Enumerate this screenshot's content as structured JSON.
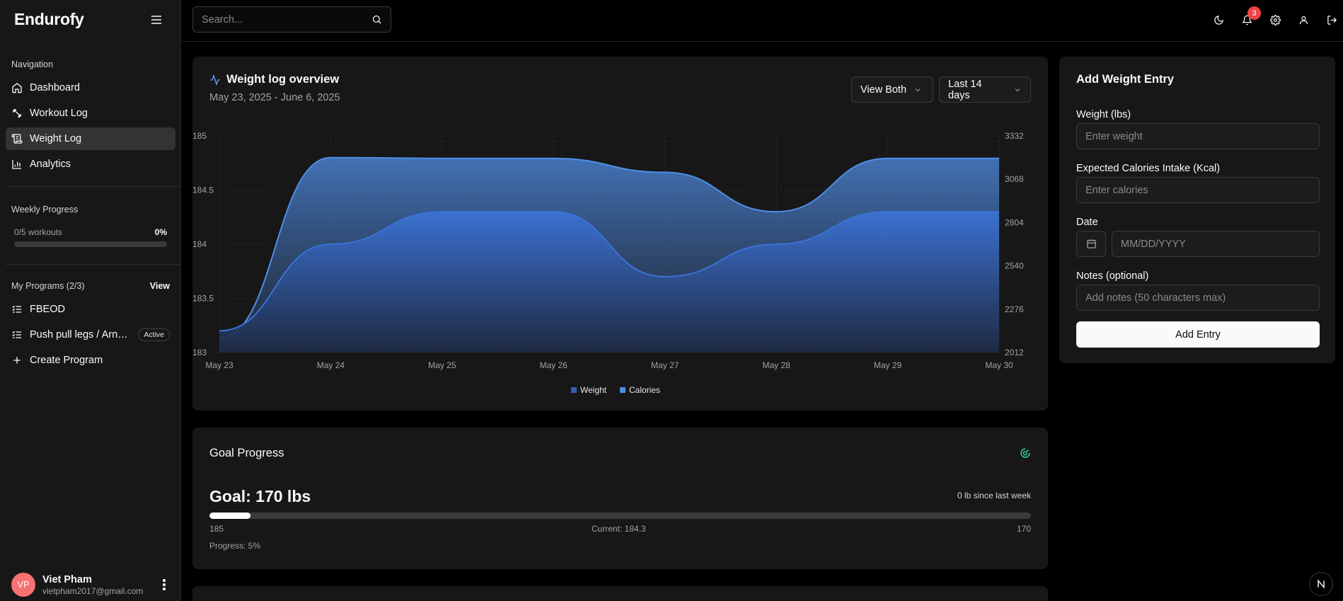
{
  "app": {
    "brand": "Endurofy"
  },
  "sidebar": {
    "nav_title": "Navigation",
    "nav_items": [
      {
        "label": "Dashboard",
        "icon": "home-icon"
      },
      {
        "label": "Workout Log",
        "icon": "dumbbell-icon"
      },
      {
        "label": "Weight Log",
        "icon": "scroll-icon",
        "active": true
      },
      {
        "label": "Analytics",
        "icon": "bar-chart-icon"
      }
    ],
    "weekly": {
      "title": "Weekly Progress",
      "workouts": "0/5 workouts",
      "percent": "0%",
      "progress_fraction": 0
    },
    "programs": {
      "title": "My Programs (2/3)",
      "view_label": "View",
      "items": [
        {
          "label": "FBEOD",
          "icon": "list-checks-icon"
        },
        {
          "label": "Push pull legs / Arnold",
          "icon": "list-checks-icon",
          "badge": "Active"
        }
      ],
      "create_label": "Create Program"
    },
    "user": {
      "initials": "VP",
      "name": "Viet Pham",
      "email": "vietpham2017@gmail.com"
    }
  },
  "header": {
    "search_placeholder": "Search...",
    "notification_count": "3",
    "icons": [
      "moon-icon",
      "bell-icon",
      "gear-icon",
      "user-icon",
      "logout-icon"
    ]
  },
  "chart_card": {
    "title": "Weight log overview",
    "subtitle": "May 23, 2025 - June 6, 2025",
    "view_select": "View Both",
    "range_select": "Last 14 days"
  },
  "chart_data": {
    "type": "area",
    "categories": [
      "May 23",
      "May 24",
      "May 25",
      "May 26",
      "May 27",
      "May 28",
      "May 29",
      "May 30"
    ],
    "series": [
      {
        "name": "Weight",
        "axis": "left",
        "values": [
          183.2,
          184.0,
          184.3,
          184.3,
          183.7,
          184.0,
          184.3,
          184.3
        ],
        "color": "#3b72d4"
      },
      {
        "name": "Calories",
        "axis": "right",
        "values": [
          2100,
          3200,
          3195,
          3195,
          3110,
          2870,
          3195,
          3195
        ],
        "color": "#4d8fe8"
      }
    ],
    "y_left": {
      "min": 183,
      "max": 185,
      "ticks": [
        "185",
        "184.5",
        "184",
        "183.5",
        "183"
      ]
    },
    "y_right": {
      "min": 2012,
      "max": 3332,
      "ticks": [
        "3332",
        "3068",
        "2804",
        "2540",
        "2276",
        "2012"
      ]
    },
    "legend": [
      "Weight",
      "Calories"
    ],
    "legend_position": "bottom",
    "grid": true
  },
  "goal": {
    "title": "Goal Progress",
    "goal_text": "Goal: 170 lbs",
    "since": "0 lb since last week",
    "start": "185",
    "current": "Current: 184.3",
    "target": "170",
    "progress_text": "Progress: 5%",
    "progress_fraction": 0.05
  },
  "form": {
    "title": "Add Weight Entry",
    "weight_label": "Weight (lbs)",
    "weight_placeholder": "Enter weight",
    "calories_label": "Expected Calories Intake (Kcal)",
    "calories_placeholder": "Enter calories",
    "date_label": "Date",
    "date_placeholder": "MM/DD/YYYY",
    "notes_label": "Notes (optional)",
    "notes_placeholder": "Add notes (50 characters max)",
    "submit_label": "Add Entry"
  },
  "colors": {
    "accent": "#3b82f6",
    "goal_icon": "#34d399",
    "badge": "#ef4444",
    "avatar": "#f87171"
  }
}
